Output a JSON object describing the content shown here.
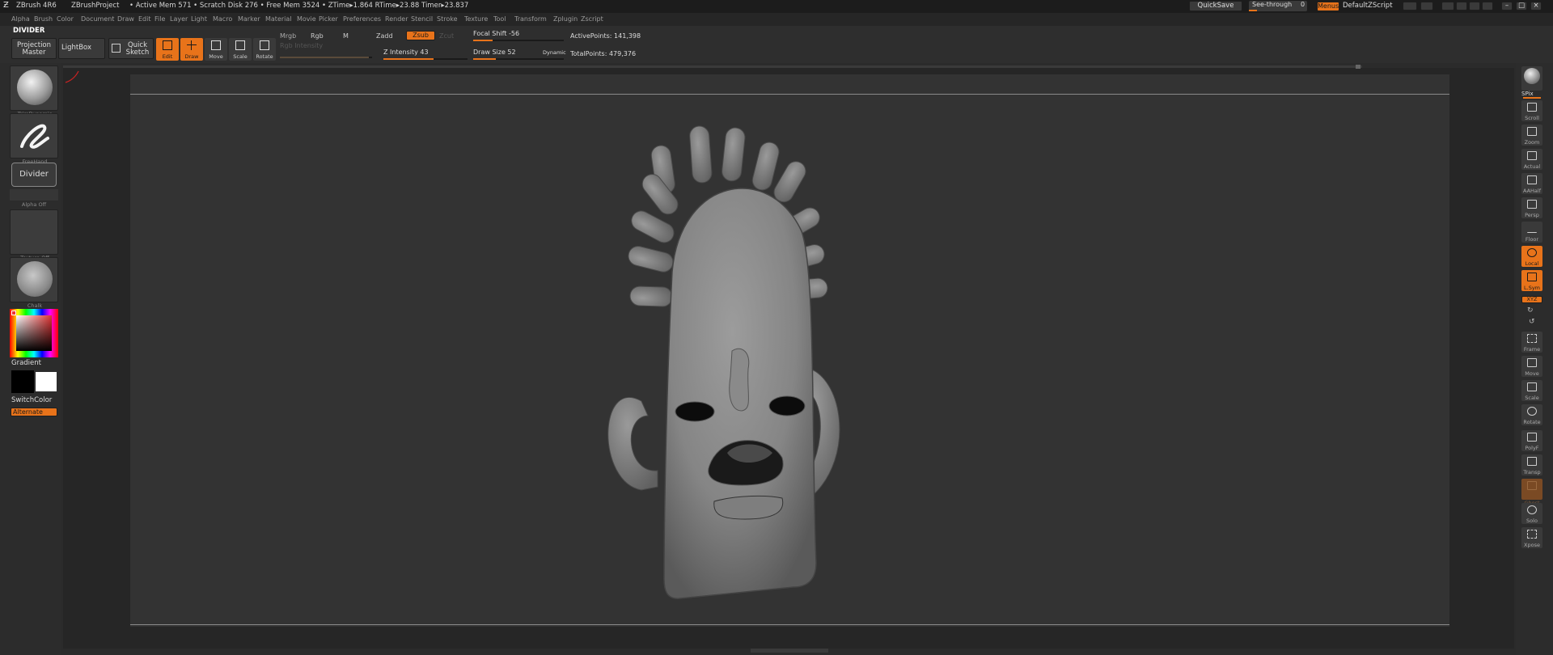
{
  "titlebar": {
    "app_name": "ZBrush 4R6",
    "project": "ZBrushProject",
    "mem_info": "• Active Mem 571 • Scratch Disk 276 • Free Mem 3524 • ZTime▸1.864 RTime▸23.88 Timer▸23.837",
    "quicksave": "QuickSave",
    "see_through_label": "See-through",
    "see_through_value": "0",
    "menus": "Menus",
    "default_script": "DefaultZScript"
  },
  "menubar": {
    "items": [
      "Alpha",
      "Brush",
      "Color",
      "Document",
      "Draw",
      "Edit",
      "File",
      "Layer",
      "Light",
      "Macro",
      "Marker",
      "Material",
      "Movie",
      "Picker",
      "Preferences",
      "Render",
      "Stencil",
      "Stroke",
      "Texture",
      "Tool",
      "Transform",
      "Zplugin",
      "Zscript"
    ]
  },
  "palette_title": "DIVIDER",
  "shelf": {
    "projection_master": "Projection Master",
    "lightbox": "LightBox",
    "quick_sketch": "Quick Sketch",
    "edit": "Edit",
    "draw": "Draw",
    "move": "Move",
    "scale": "Scale",
    "rotate": "Rotate",
    "mrgb": "Mrgb",
    "rgb": "Rgb",
    "m": "M",
    "zadd": "Zadd",
    "zsub": "Zsub",
    "zcut": "Zcut",
    "rgb_intensity": "Rgb Intensity",
    "z_intensity": "Z Intensity 43",
    "focal_shift": "Focal Shift -56",
    "draw_size": "Draw Size 52",
    "dynamic": "Dynamic",
    "active_points": "ActivePoints: 141,398",
    "total_points": "TotalPoints: 479,376"
  },
  "left_tray": {
    "brush_caption": "TrimDynamic",
    "stroke_caption": "FreeHand",
    "divider_button": "Divider",
    "alpha_caption": "Alpha Off",
    "texture_caption": "Texture Off",
    "material_caption": "Chalk",
    "gradient": "Gradient",
    "switch_color": "SwitchColor",
    "alternate": "Alternate"
  },
  "right_tray": {
    "items": [
      "SPix",
      "Scroll",
      "Zoom",
      "Actual",
      "AAHalf",
      "Persp",
      "Floor",
      "Local",
      "L.Sym",
      "XYZ",
      "Frame",
      "Move",
      "Scale",
      "Rotate",
      "PolyF",
      "Transp",
      "Ghost",
      "Solo",
      "Xpose"
    ]
  },
  "colors": {
    "accent": "#e8731a",
    "canvas": "#333333",
    "model": "#8c8c8c"
  }
}
